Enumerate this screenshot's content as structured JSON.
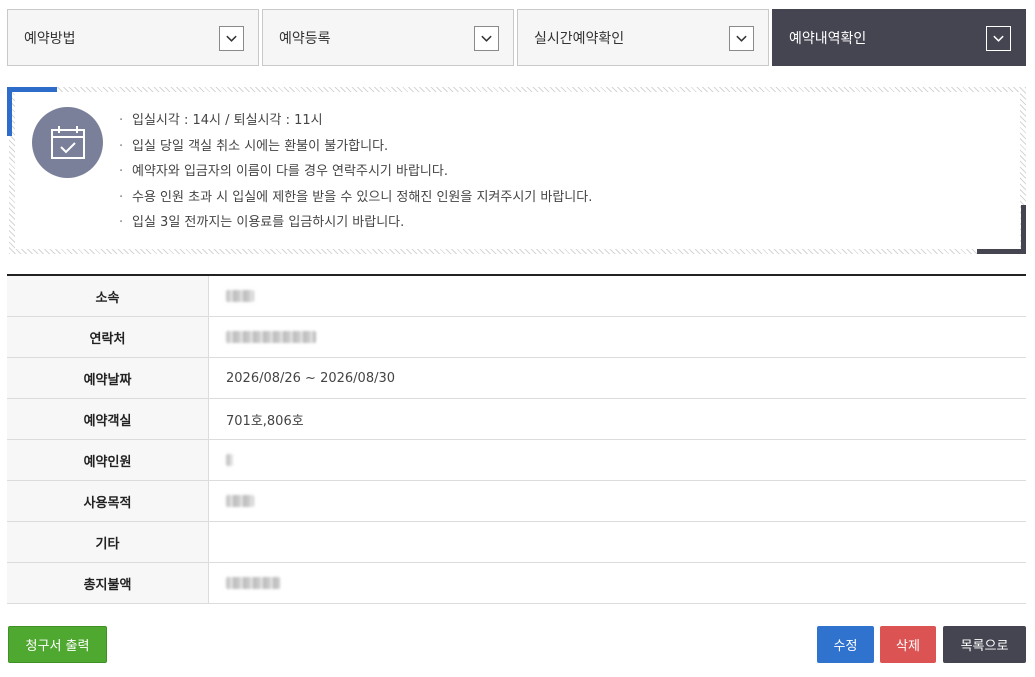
{
  "tabs": [
    {
      "label": "예약방법",
      "active": false
    },
    {
      "label": "예약등록",
      "active": false
    },
    {
      "label": "실시간예약확인",
      "active": false
    },
    {
      "label": "예약내역확인",
      "active": true
    }
  ],
  "notice": {
    "icon": "calendar-check-icon",
    "items": [
      "입실시각 : 14시 / 퇴실시각 : 11시",
      "입실 당일 객실 취소 시에는 환불이 불가합니다.",
      "예약자와 입금자의 이름이 다를 경우 연락주시기 바랍니다.",
      "수용 인원 초과 시 입실에 제한을 받을 수 있으니 정해진 인원을 지켜주시기 바랍니다.",
      "입실 3일 전까지는 이용료를 입금하시기 바랍니다."
    ]
  },
  "details": {
    "affiliation": {
      "label": "소속",
      "value": ""
    },
    "contact": {
      "label": "연락처",
      "value": ""
    },
    "date": {
      "label": "예약날짜",
      "value": "2026/08/26 ~ 2026/08/30"
    },
    "rooms": {
      "label": "예약객실",
      "value": "701호,806호"
    },
    "people": {
      "label": "예약인원",
      "value": ""
    },
    "purpose": {
      "label": "사용목적",
      "value": ""
    },
    "etc": {
      "label": "기타",
      "value": ""
    },
    "total": {
      "label": "총지불액",
      "value": ""
    }
  },
  "buttons": {
    "invoice": "청구서 출력",
    "edit": "수정",
    "delete": "삭제",
    "list": "목록으로"
  },
  "colors": {
    "active_tab": "#444550",
    "accent_blue": "#2d6dc9",
    "invoice_green": "#4fa82f",
    "delete_red": "#db5453"
  }
}
